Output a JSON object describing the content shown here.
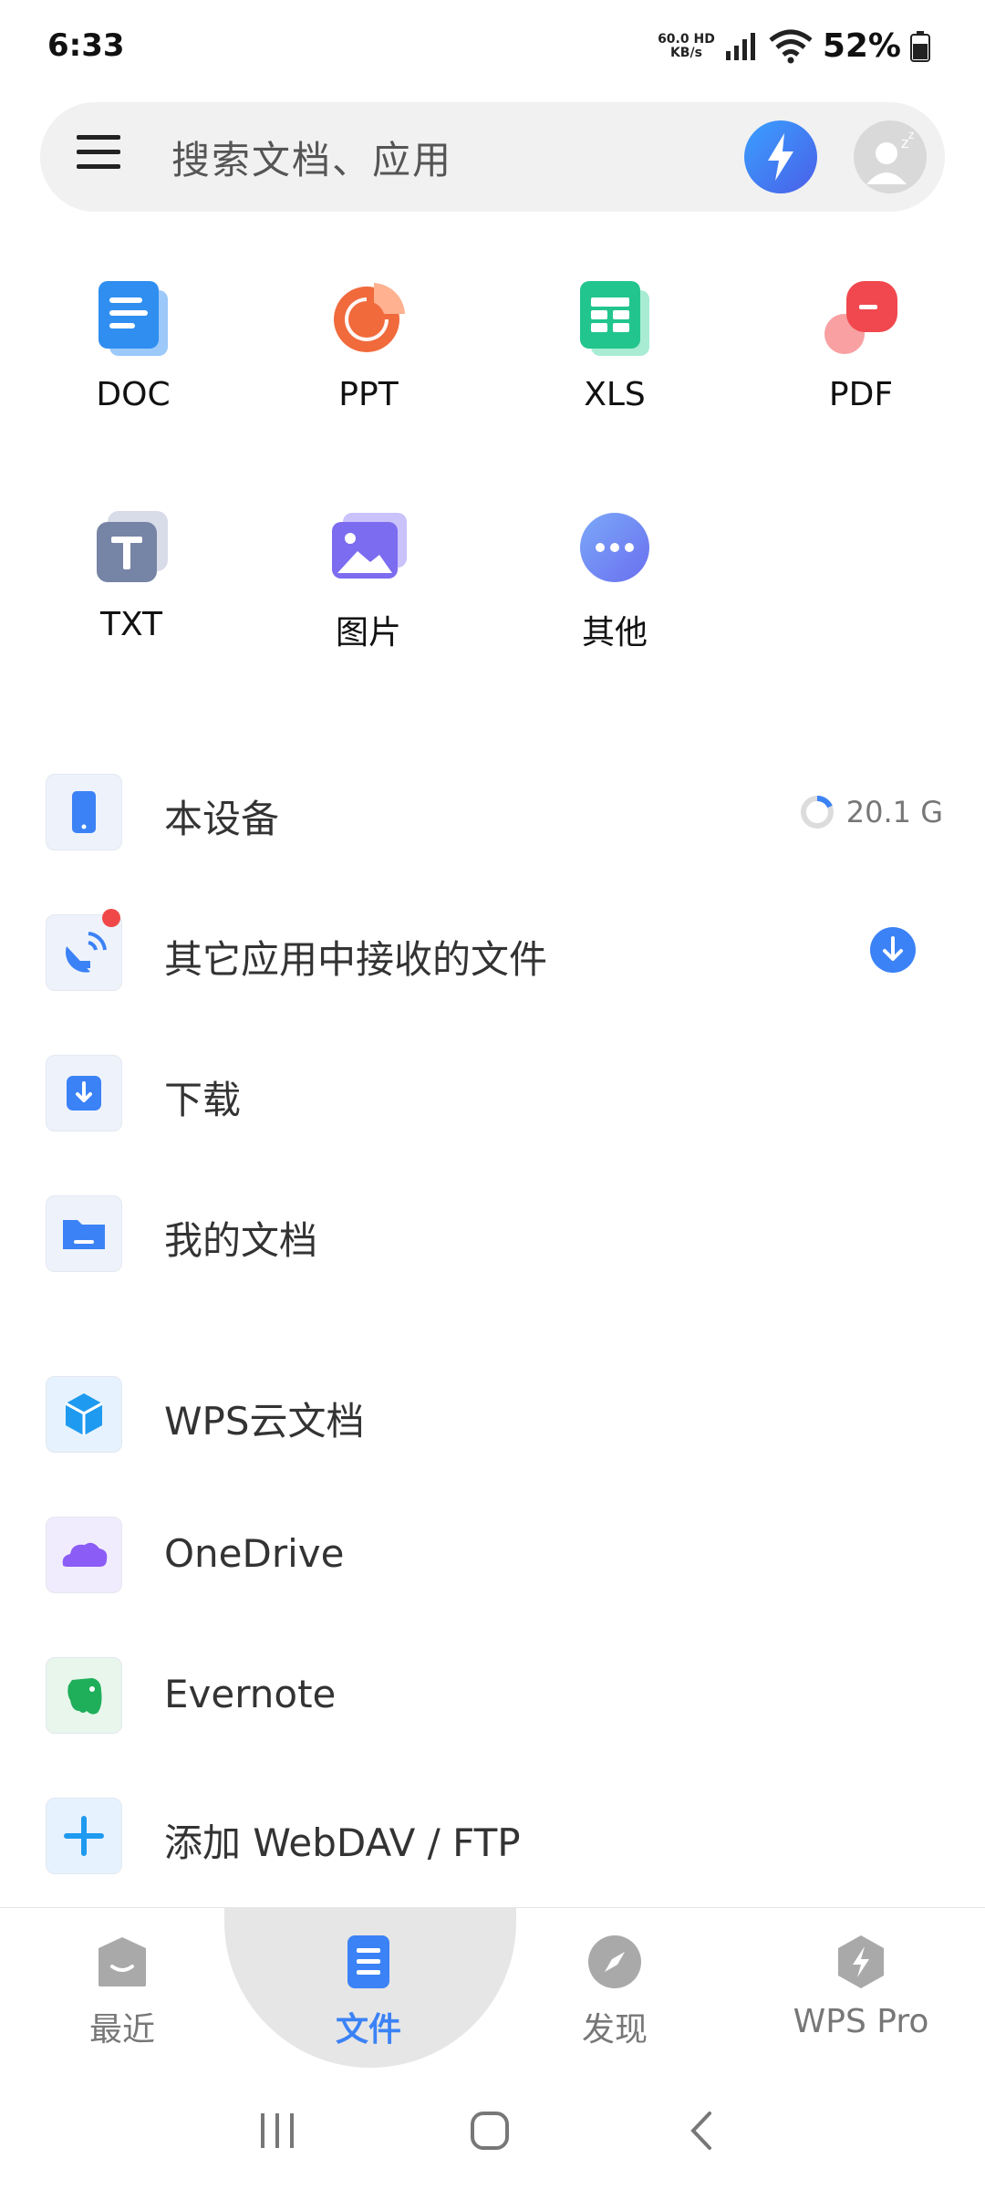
{
  "status": {
    "time": "6:33",
    "network_speed": "60.0",
    "network_unit": "KB/s",
    "hd": "HD",
    "battery": "52%"
  },
  "search": {
    "placeholder": "搜索文档、应用"
  },
  "categories": [
    {
      "label": "DOC",
      "icon": "doc-icon",
      "color": "#2f8ef0"
    },
    {
      "label": "PPT",
      "icon": "ppt-icon",
      "color": "#f06a3c"
    },
    {
      "label": "XLS",
      "icon": "xls-icon",
      "color": "#22c58e"
    },
    {
      "label": "PDF",
      "icon": "pdf-icon",
      "color": "#f0484e"
    },
    {
      "label": "TXT",
      "icon": "txt-icon",
      "color": "#7684a6"
    },
    {
      "label": "图片",
      "icon": "image-icon",
      "color": "#7b6cf0"
    },
    {
      "label": "其他",
      "icon": "more-icon",
      "color": "#5b8df0"
    }
  ],
  "local": [
    {
      "label": "本设备",
      "icon": "phone-icon",
      "storage": "20.1 G"
    },
    {
      "label": "其它应用中接收的文件",
      "icon": "satellite-icon"
    },
    {
      "label": "下载",
      "icon": "download-icon"
    },
    {
      "label": "我的文档",
      "icon": "folder-icon"
    }
  ],
  "cloud": [
    {
      "label": "WPS云文档",
      "icon": "cube-icon"
    },
    {
      "label": "OneDrive",
      "icon": "onedrive-icon"
    },
    {
      "label": "Evernote",
      "icon": "evernote-icon"
    },
    {
      "label": "添加 WebDAV / FTP",
      "icon": "plus-icon"
    }
  ],
  "bottom_nav": [
    {
      "label": "最近",
      "icon": "recent-icon"
    },
    {
      "label": "文件",
      "icon": "file-icon",
      "active": true
    },
    {
      "label": "发现",
      "icon": "compass-icon"
    },
    {
      "label": "WPS Pro",
      "icon": "wps-pro-icon"
    }
  ],
  "colors": {
    "accent": "#3b82f6",
    "badge_red": "#f04848"
  }
}
